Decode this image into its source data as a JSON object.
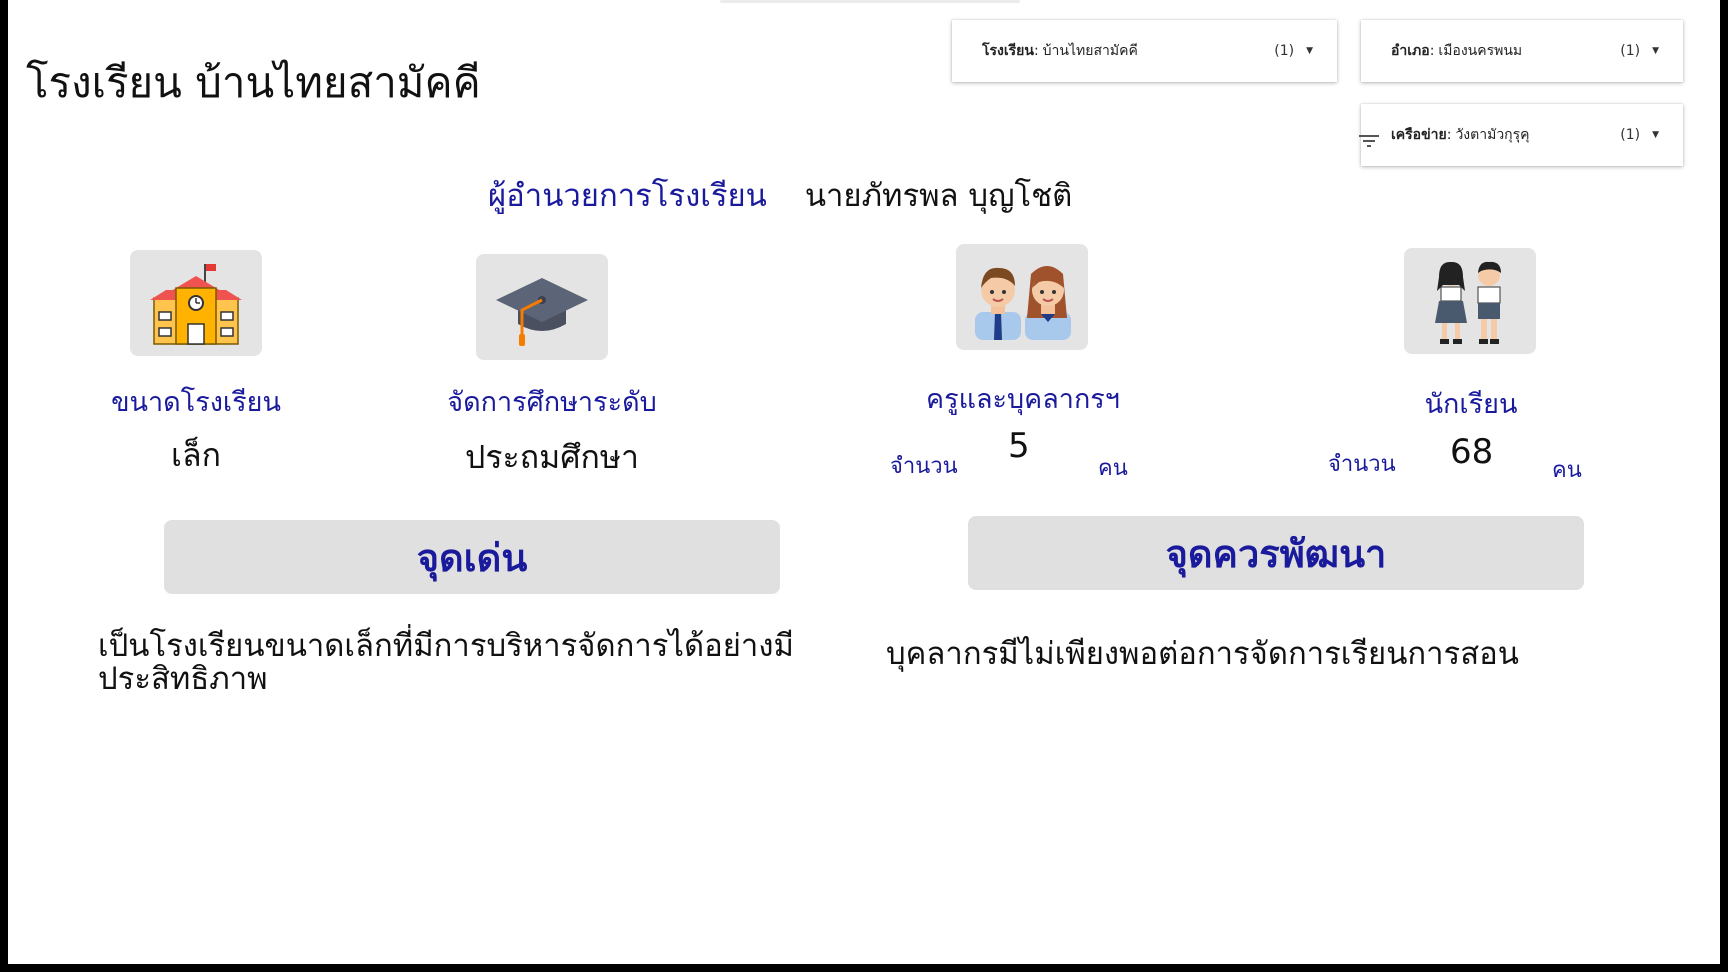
{
  "page": {
    "title": "โรงเรียน บ้านไทยสามัคคี"
  },
  "filters": [
    {
      "key": "โรงเรียน",
      "value": "บ้านไทยสามัคคี",
      "count": "(1)"
    },
    {
      "key": "อำเภอ",
      "value": "เมืองนครพนม",
      "count": "(1)"
    },
    {
      "key": "เครือข่าย",
      "value": "วังตามัวกุรุคุ",
      "count": "(1)"
    }
  ],
  "director": {
    "label": "ผู้อำนวยการโรงเรียน",
    "name": "นายภัทรพล บุญโชติ"
  },
  "stats": {
    "size": {
      "icon": "school-building-icon",
      "label": "ขนาดโรงเรียน",
      "value": "เล็ก"
    },
    "level": {
      "icon": "graduation-cap-icon",
      "label": "จัดการศึกษาระดับ",
      "value": "ประถมศึกษา"
    },
    "teachers": {
      "icon": "teachers-icon",
      "label": "ครูและบุคลากรฯ",
      "prefix": "จำนวน",
      "value": "5",
      "unit": "คน"
    },
    "students": {
      "icon": "students-icon",
      "label": "นักเรียน",
      "prefix": "จำนวน",
      "value": "68",
      "unit": "คน"
    }
  },
  "strengths": {
    "heading": "จุดเด่น",
    "text": "เป็นโรงเรียนขนาดเล็กที่มีการบริหารจัดการได้อย่างมีประสิทธิภาพ"
  },
  "improvements": {
    "heading": "จุดควรพัฒนา",
    "text": "บุคลากรมีไม่เพียงพอต่อการจัดการเรียนการสอน"
  },
  "colors": {
    "accent": "#1a1a9c",
    "banner_bg": "#e0e0e0",
    "icon_bg": "#e4e4e4",
    "frame": "#000000"
  }
}
